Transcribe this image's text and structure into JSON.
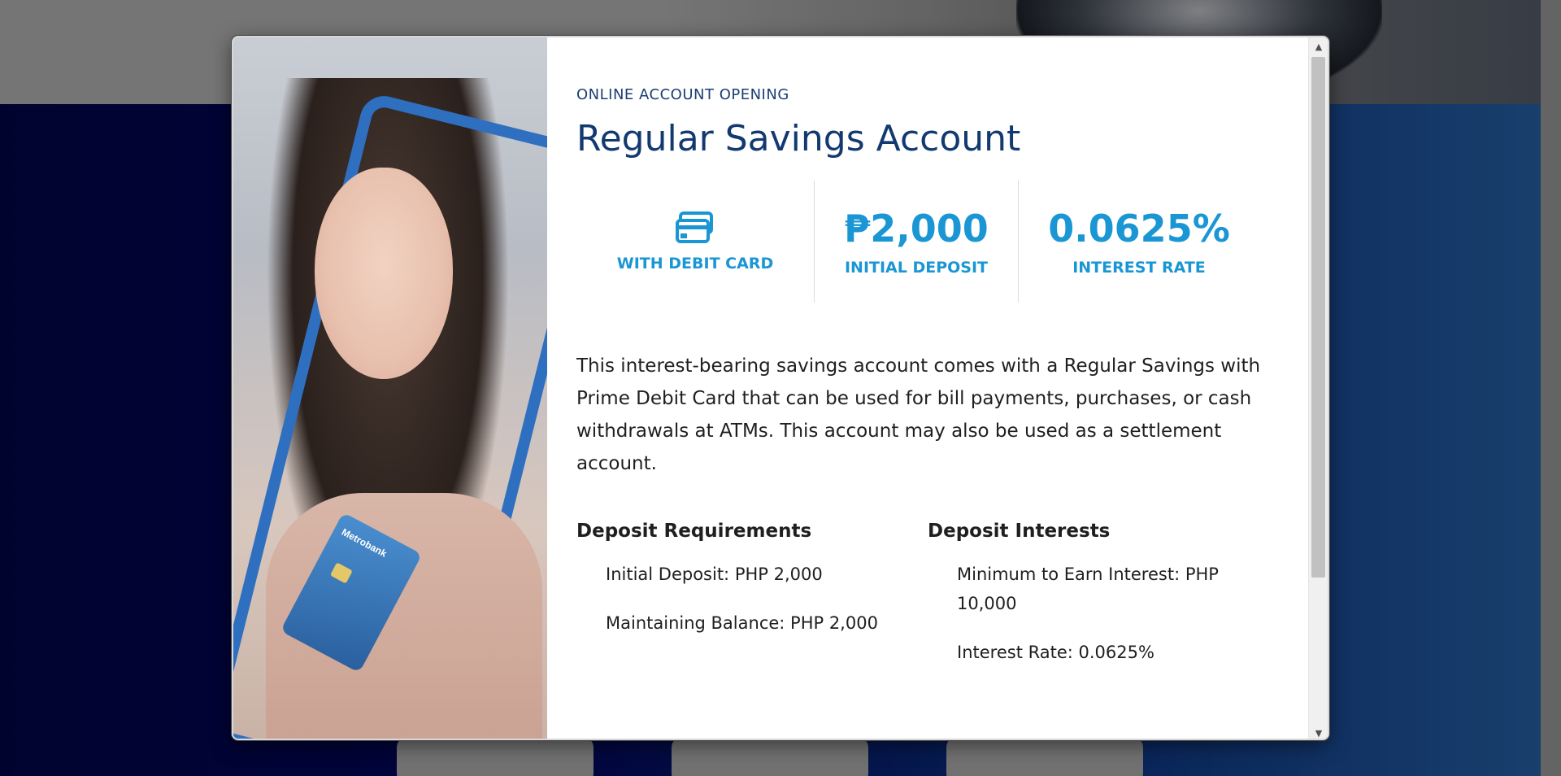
{
  "modal": {
    "eyebrow": "ONLINE ACCOUNT OPENING",
    "title": "Regular Savings Account",
    "stats": [
      {
        "icon": "debit-card-icon",
        "label": "WITH DEBIT CARD"
      },
      {
        "value": "₱2,000",
        "label": "INITIAL DEPOSIT"
      },
      {
        "value": "0.0625%",
        "label": "INTEREST RATE"
      }
    ],
    "description": "This interest-bearing savings account comes with a Regular Savings with Prime Debit Card that can be used for bill payments, purchases, or cash withdrawals at ATMs. This account may also be used as a settlement account.",
    "deposit_requirements": {
      "title": "Deposit Requirements",
      "items": [
        "Initial Deposit: PHP 2,000",
        "Maintaining Balance: PHP 2,000"
      ]
    },
    "deposit_interests": {
      "title": "Deposit Interests",
      "items": [
        "Minimum to Earn Interest: PHP 10,000",
        "Interest Rate: 0.0625%"
      ]
    },
    "photo_card_brand": "Metrobank"
  },
  "colors": {
    "accent": "#1a96d4",
    "title": "#123a70",
    "background_navy": "#02043a"
  }
}
